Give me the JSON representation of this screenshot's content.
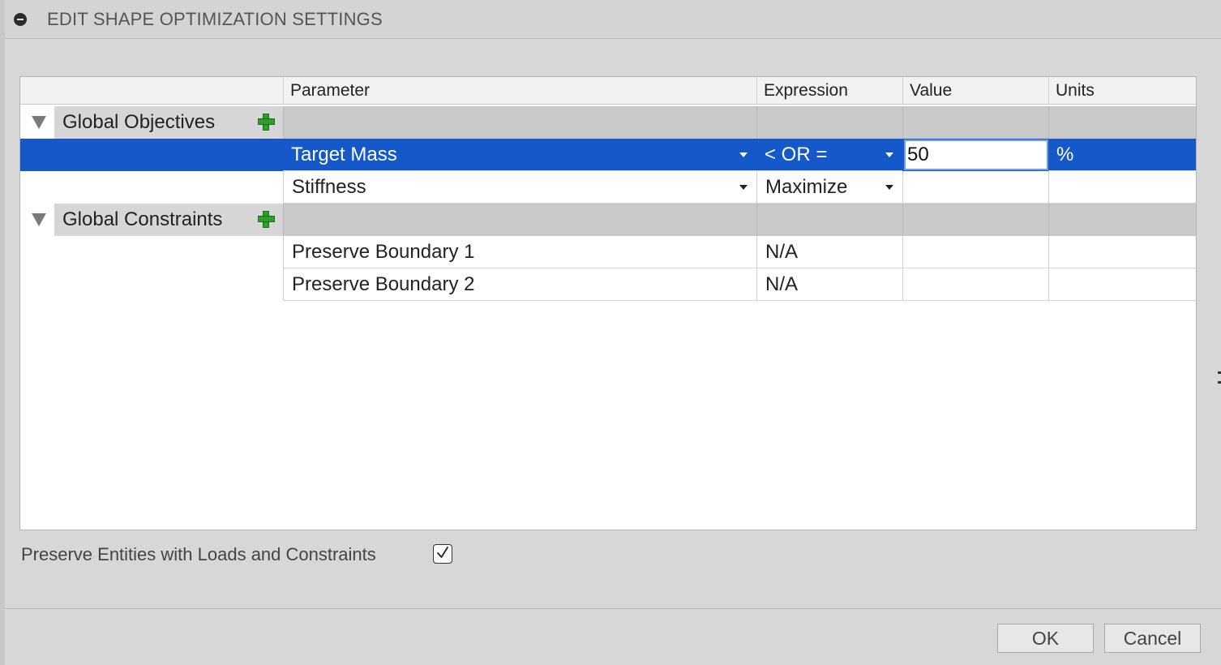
{
  "dialog": {
    "title": "EDIT SHAPE OPTIMIZATION SETTINGS"
  },
  "table": {
    "columns": [
      "Parameter",
      "Expression",
      "Value",
      "Units"
    ],
    "groups": [
      {
        "label": "Global Objectives",
        "rows": [
          {
            "parameter": "Target Mass",
            "expression": "< OR =",
            "value": "50",
            "units": "%",
            "selected": true
          },
          {
            "parameter": "Stiffness",
            "expression": "Maximize",
            "value": "",
            "units": ""
          }
        ]
      },
      {
        "label": "Global Constraints",
        "rows": [
          {
            "parameter": "Preserve Boundary 1",
            "expression": "N/A",
            "value": "",
            "units": ""
          },
          {
            "parameter": "Preserve Boundary 2",
            "expression": "N/A",
            "value": "",
            "units": ""
          }
        ]
      }
    ]
  },
  "options": {
    "preserve_label": "Preserve Entities with Loads and Constraints",
    "preserve_checked": true
  },
  "buttons": {
    "ok": "OK",
    "cancel": "Cancel"
  },
  "colors": {
    "selection": "#1558c9",
    "add_icon": "#2e9f2b"
  }
}
